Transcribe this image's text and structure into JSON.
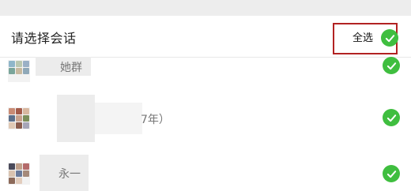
{
  "header": {
    "title": "请选择会话",
    "select_all_label": "全选"
  },
  "conversations": [
    {
      "name": "她群",
      "selected": true
    },
    {
      "name": "7年）",
      "selected": true
    },
    {
      "name": "永一",
      "selected": true
    }
  ],
  "colors": {
    "check_green": "#3fbe3f",
    "highlight_border": "#b22222"
  },
  "icons": [
    "check-icon",
    "group-avatar"
  ]
}
